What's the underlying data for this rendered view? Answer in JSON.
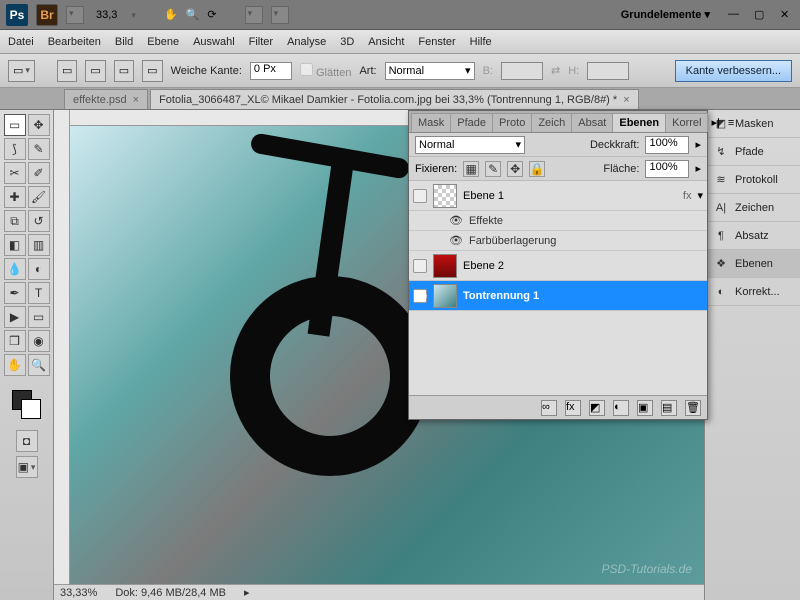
{
  "appbar": {
    "zoom": "33,3",
    "workspace": "Grundelemente ▾"
  },
  "menu": [
    "Datei",
    "Bearbeiten",
    "Bild",
    "Ebene",
    "Auswahl",
    "Filter",
    "Analyse",
    "3D",
    "Ansicht",
    "Fenster",
    "Hilfe"
  ],
  "optbar": {
    "weiche_label": "Weiche Kante:",
    "weiche_val": "0 Px",
    "glaetten": "Glätten",
    "art_label": "Art:",
    "art_val": "Normal",
    "b_label": "B:",
    "h_label": "H:",
    "refine": "Kante verbessern..."
  },
  "tabs": {
    "t1": "effekte.psd",
    "t2": "Fotolia_3066487_XL© Mikael Damkier - Fotolia.com.jpg bei 33,3% (Tontrennung 1, RGB/8#) *"
  },
  "panelTabs": [
    "Mask",
    "Pfade",
    "Proto",
    "Zeich",
    "Absat",
    "Ebenen",
    "Korrel"
  ],
  "panel": {
    "blend": "Normal",
    "deck_lbl": "Deckkraft:",
    "deck_val": "100%",
    "fix_lbl": "Fixieren:",
    "flaeche_lbl": "Fläche:",
    "flaeche_val": "100%"
  },
  "layers": {
    "l1": "Ebene 1",
    "fx": "Effekte",
    "fxsub": "Farbüberlagerung",
    "l2": "Ebene 2",
    "l3": "Tontrennung 1",
    "fxbadge": "fx"
  },
  "rside": [
    "Masken",
    "Pfade",
    "Protokoll",
    "Zeichen",
    "Absatz",
    "Ebenen",
    "Korrekt..."
  ],
  "status": {
    "zoom": "33,33%",
    "doc": "Dok: 9,46 MB/28,4 MB"
  },
  "watermark": "PSD-Tutorials.de"
}
